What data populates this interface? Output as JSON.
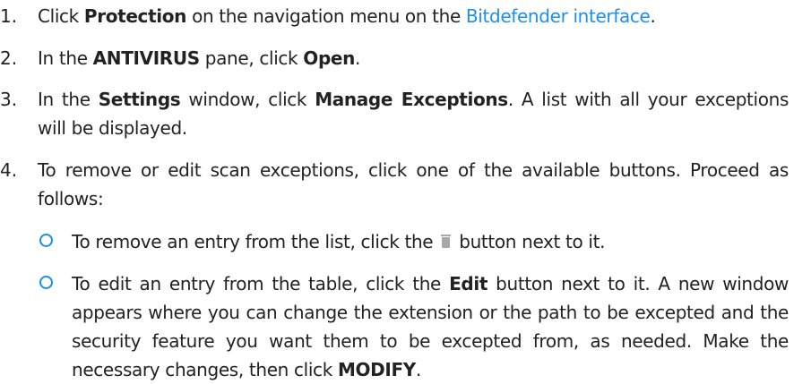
{
  "steps": [
    {
      "num": "1.",
      "parts": [
        "Click ",
        "Protection",
        " on the navigation menu on the ",
        "Bitdefender interface",
        "."
      ]
    },
    {
      "num": "2.",
      "parts": [
        "In the ",
        "ANTIVIRUS",
        " pane, click ",
        "Open",
        "."
      ]
    },
    {
      "num": "3.",
      "parts": [
        "In the ",
        "Settings",
        " window, click ",
        "Manage Exceptions",
        ". A list with all your exceptions will be displayed."
      ]
    },
    {
      "num": "4.",
      "parts": [
        "To remove or edit scan exceptions, click one of the available buttons. Proceed as follows:"
      ]
    }
  ],
  "substeps": [
    {
      "parts": [
        "To remove an entry from the list, click the ",
        " button next to it."
      ],
      "icon": "trash-icon"
    },
    {
      "parts": [
        "To edit an entry from the table, click the ",
        "Edit",
        " button next to it. A new window appears where you can change the extension or the path to be excepted and the security feature you want them to be excepted from, as needed. Make the necessary changes, then click ",
        "MODIFY",
        "."
      ]
    }
  ],
  "colors": {
    "link": "#1d8fe8",
    "bullet": "#1d8fe8",
    "text": "#222222"
  }
}
